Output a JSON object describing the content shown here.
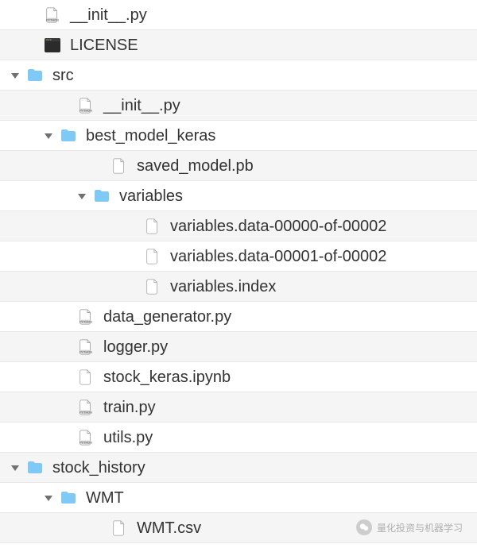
{
  "rows": [
    {
      "indent": 1,
      "expanded": null,
      "icon": "python",
      "label": "__init__.py"
    },
    {
      "indent": 1,
      "expanded": null,
      "icon": "terminal",
      "label": "LICENSE"
    },
    {
      "indent": 0,
      "expanded": "down",
      "icon": "folder",
      "label": "src"
    },
    {
      "indent": 2,
      "expanded": null,
      "icon": "python",
      "label": "__init__.py"
    },
    {
      "indent": 1,
      "expanded": "down",
      "icon": "folder",
      "label": "best_model_keras"
    },
    {
      "indent": 3,
      "expanded": null,
      "icon": "file",
      "label": "saved_model.pb"
    },
    {
      "indent": 2,
      "expanded": "down",
      "icon": "folder",
      "label": "variables"
    },
    {
      "indent": 4,
      "expanded": null,
      "icon": "file",
      "label": "variables.data-00000-of-00002"
    },
    {
      "indent": 4,
      "expanded": null,
      "icon": "file",
      "label": "variables.data-00001-of-00002"
    },
    {
      "indent": 4,
      "expanded": null,
      "icon": "file",
      "label": "variables.index"
    },
    {
      "indent": 2,
      "expanded": null,
      "icon": "python",
      "label": "data_generator.py"
    },
    {
      "indent": 2,
      "expanded": null,
      "icon": "python",
      "label": "logger.py"
    },
    {
      "indent": 2,
      "expanded": null,
      "icon": "file",
      "label": "stock_keras.ipynb"
    },
    {
      "indent": 2,
      "expanded": null,
      "icon": "python",
      "label": "train.py"
    },
    {
      "indent": 2,
      "expanded": null,
      "icon": "python",
      "label": "utils.py"
    },
    {
      "indent": 0,
      "expanded": "down",
      "icon": "folder",
      "label": "stock_history"
    },
    {
      "indent": 1,
      "expanded": "down",
      "icon": "folder",
      "label": "WMT"
    },
    {
      "indent": 3,
      "expanded": null,
      "icon": "file",
      "label": "WMT.csv"
    }
  ],
  "indent_unit": 42,
  "base_pad": 12,
  "watermark": "量化投资与机器学习"
}
